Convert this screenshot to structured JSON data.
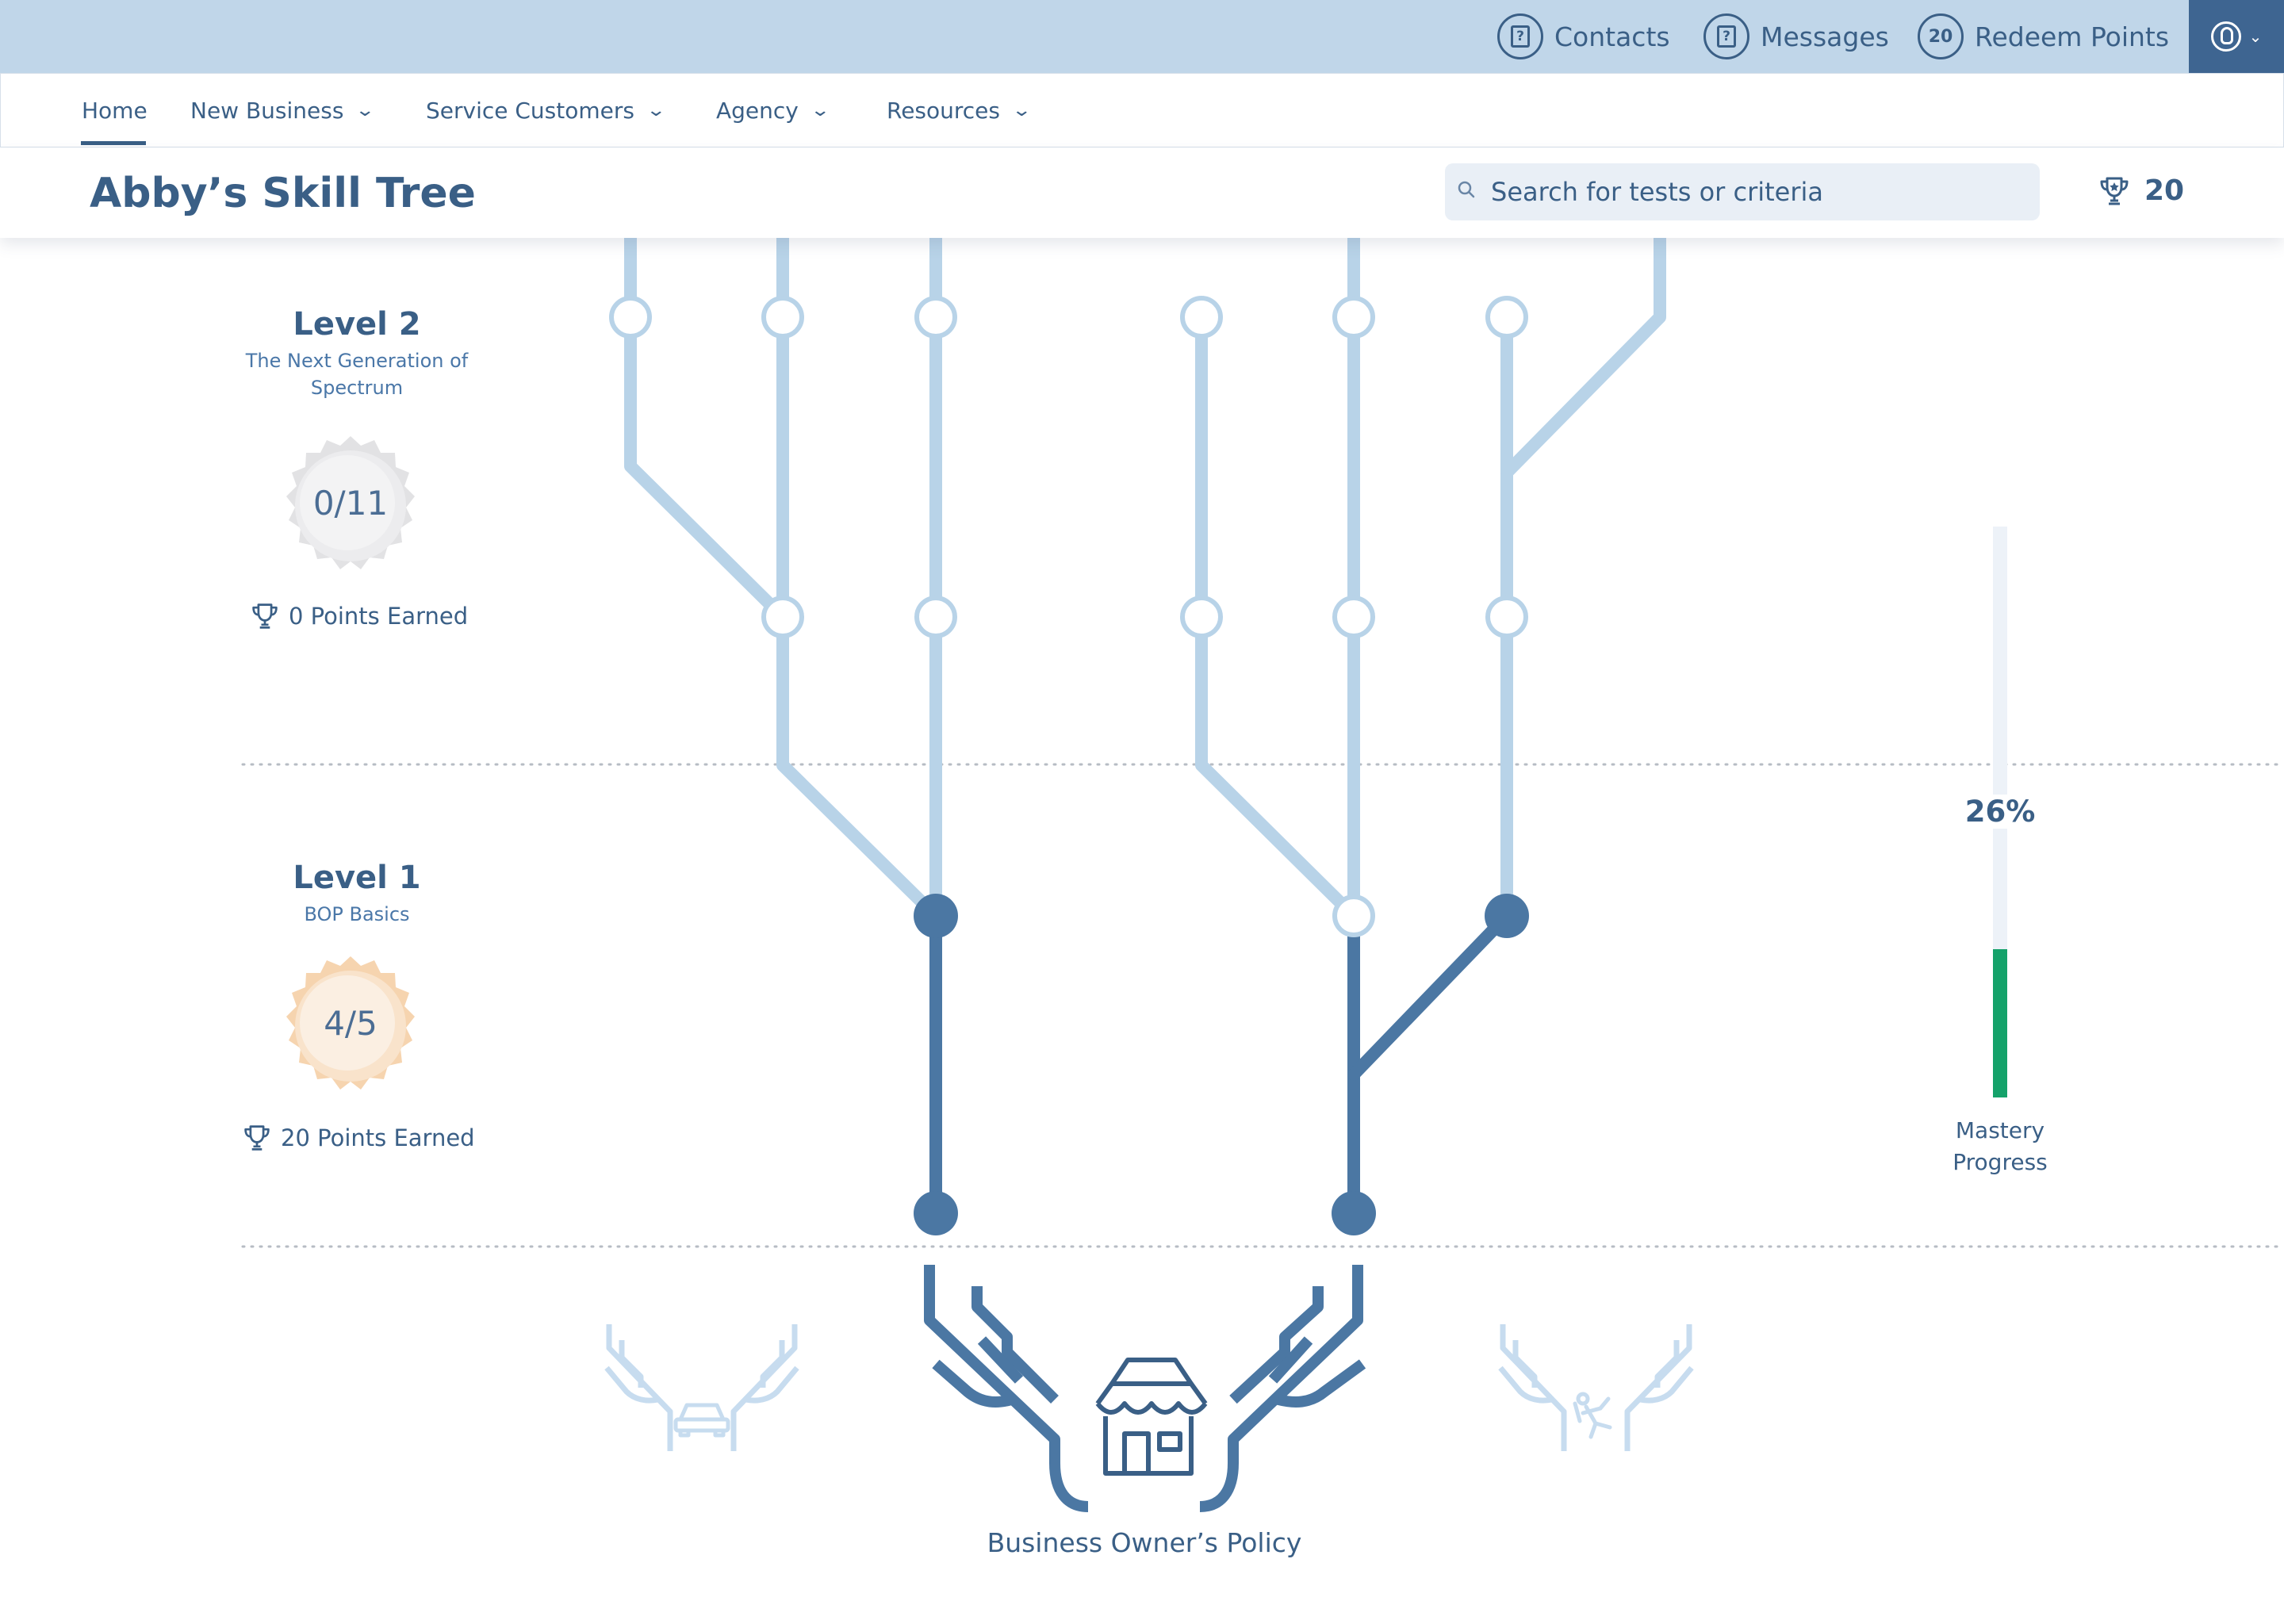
{
  "topbar": {
    "contacts_label": "Contacts",
    "messages_label": "Messages",
    "redeem_count": "20",
    "redeem_label": "Redeem Points"
  },
  "nav": {
    "items": [
      {
        "label": "Home",
        "active": true
      },
      {
        "label": "New Business"
      },
      {
        "label": "Service Customers"
      },
      {
        "label": "Agency"
      },
      {
        "label": "Resources"
      }
    ]
  },
  "header": {
    "title": "Abby’s Skill Tree",
    "search_placeholder": "Search for tests or criteria",
    "points_total": "20"
  },
  "levels": [
    {
      "title": "Level 2",
      "subtitle_line1": "The Next Generation  of",
      "subtitle_line2": "Spectrum",
      "progress": "0/11",
      "points": "0 Points Earned"
    },
    {
      "title": "Level 1",
      "subtitle_line1": "BOP Basics",
      "progress": "4/5",
      "points": "20 Points Earned"
    }
  ],
  "mastery": {
    "percent_label": "26%",
    "value": 26,
    "label_line1": "Mastery",
    "label_line2": "Progress"
  },
  "root": {
    "label": "Business Owner’s Policy"
  },
  "colors": {
    "topbar": "#c0d6e9",
    "primary": "#3a5f86",
    "branch_light": "#b8d3e8",
    "branch_dark": "#4b77a3",
    "progress_fill": "#15a26a",
    "badge_gold": "#f6d4af",
    "badge_gray": "#e2e2e4"
  },
  "icons": [
    "contacts-icon",
    "messages-icon",
    "user-icon",
    "search-icon",
    "trophy-icon",
    "shop-icon",
    "car-icon",
    "person-falling-icon"
  ]
}
